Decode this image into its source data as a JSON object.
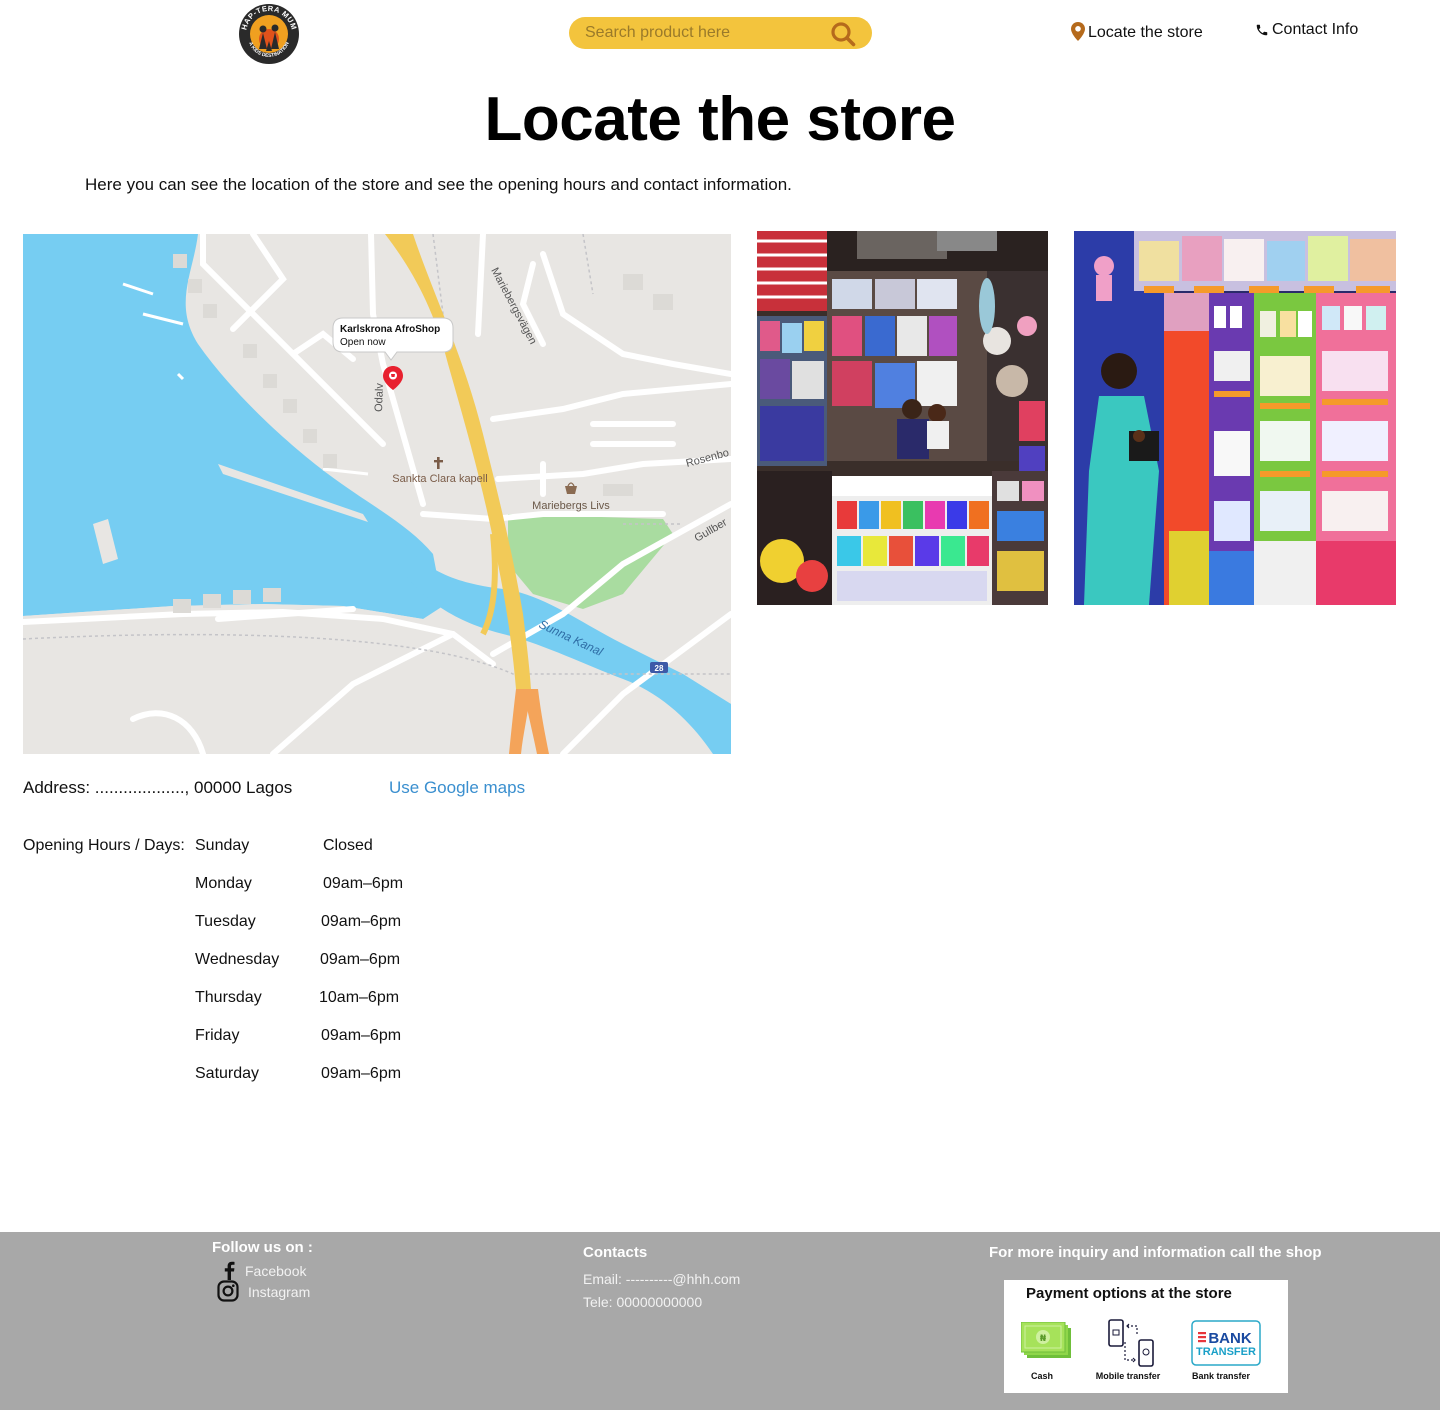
{
  "header": {
    "logo_text_top": "HAP-TERA MUM",
    "logo_text_bottom": "A KIDS DESTINATION",
    "search_placeholder": "Search product here",
    "nav_locate": "Locate the store",
    "nav_contact": "Contact Info"
  },
  "main": {
    "title": "Locate the store",
    "intro": "Here you can see the location of the store and see the opening hours and contact information."
  },
  "map": {
    "store_name": "Karlskrona AfroShop",
    "store_status": "Open now",
    "labels": {
      "street_1": "Mariebergsvägen",
      "street_2": "Odalv",
      "street_3": "Rosenbo",
      "street_4": "Gullber",
      "chapel": "Sankta Clara kapell",
      "shop": "Mariebergs Livs",
      "canal": "Sunna Kanal",
      "route": "28"
    },
    "colors": {
      "water": "#76cdf2",
      "land": "#e8e6e3",
      "park": "#a9dca0",
      "highway": "#f2ca58",
      "highway_south": "#f4a45a",
      "pin": "#e8212f"
    }
  },
  "location": {
    "address": "Address: ..................., 00000 Lagos",
    "google_maps_link": "Use Google maps"
  },
  "hours": {
    "label": "Opening Hours / Days:",
    "days": [
      {
        "day": "Sunday",
        "time": "Closed"
      },
      {
        "day": "Monday",
        "time": "09am–6pm"
      },
      {
        "day": "Tuesday",
        "time": "09am–6pm"
      },
      {
        "day": "Wednesday",
        "time": "09am–6pm"
      },
      {
        "day": "Thursday",
        "time": "10am–6pm"
      },
      {
        "day": "Friday",
        "time": "09am–6pm"
      },
      {
        "day": "Saturday",
        "time": "09am–6pm"
      }
    ]
  },
  "footer": {
    "follow_heading": "Follow us on :",
    "facebook": "Facebook",
    "instagram": "Instagram",
    "contacts_heading": "Contacts",
    "email": "Email: ----------@hhh.com",
    "phone": "Tele: 00000000000",
    "inquiry_heading": "For more inquiry and information call the shop",
    "payment_title": "Payment options at the store",
    "payment_cash": "Cash",
    "payment_mobile": "Mobile transfer",
    "payment_bank": "Bank transfer",
    "bank_logo_line1": "BANK",
    "bank_logo_line2": "TRANSFER",
    "cash_symbol": "₦"
  },
  "colors": {
    "search_bg": "#f3c43d",
    "accent_brown": "#b56a1c",
    "link_blue": "#3a8fcf",
    "footer_bg": "#a8a8a8"
  }
}
